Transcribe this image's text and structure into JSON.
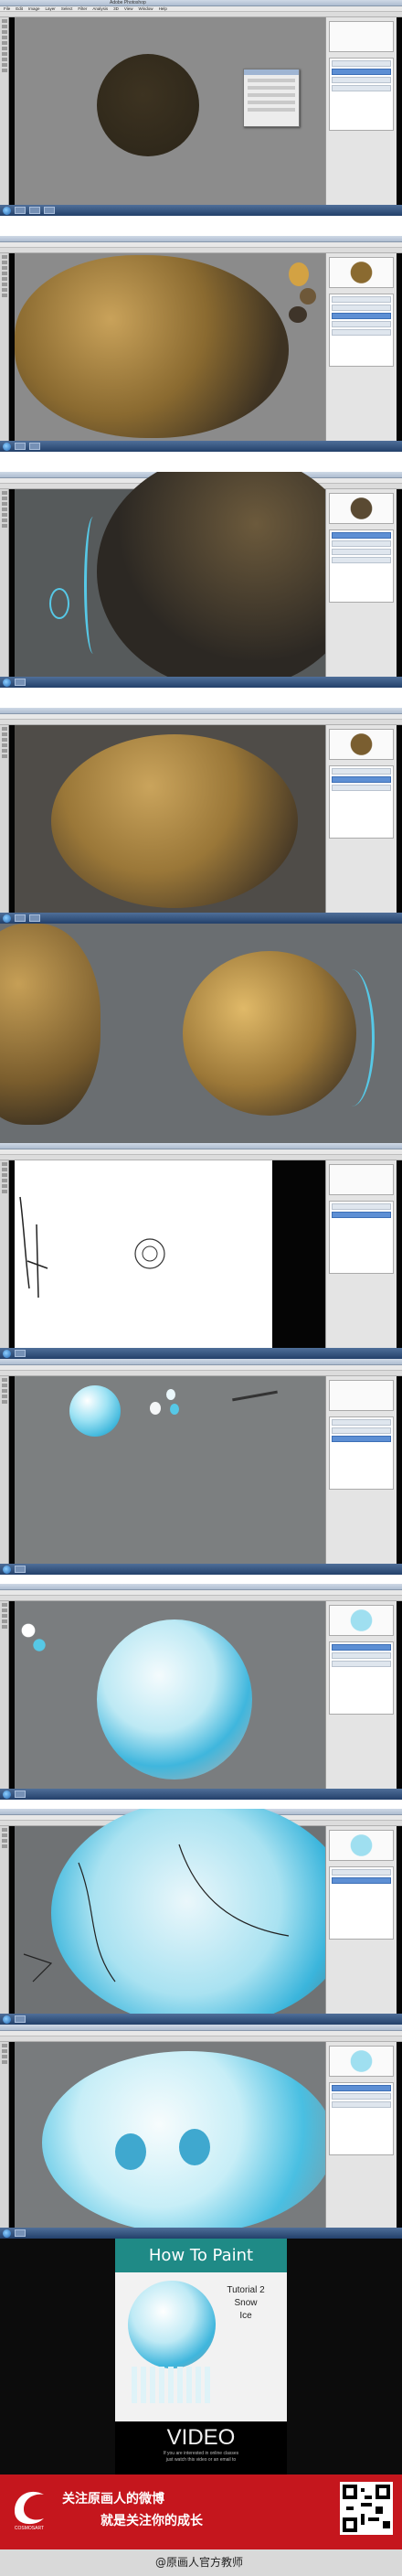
{
  "photoshop": {
    "window_title": "Adobe Photoshop",
    "menu": [
      "File",
      "Edit",
      "Image",
      "Layer",
      "Select",
      "Filter",
      "Analysis",
      "3D",
      "View",
      "Window",
      "Help"
    ]
  },
  "video_card": {
    "heading": "How To Paint",
    "subtitle_lines": [
      "Tutorial 2",
      "Snow",
      "Ice"
    ],
    "footer_big": "VIDEO",
    "footer_small_1": "If you are interested in online classes",
    "footer_small_2": "just watch this video or an email to"
  },
  "promo": {
    "line1": "关注原画人的微博",
    "line2": "就是关注你的成长",
    "logo_text": "COSMOSART",
    "weibo_handle": "@原画人官方教师"
  },
  "colors": {
    "rock": "#a27d3a",
    "ice": "#56c8e6",
    "canvas_gray": "#8c8c8c",
    "promo_red": "#c5161d",
    "video_teal": "#1f8a86"
  }
}
